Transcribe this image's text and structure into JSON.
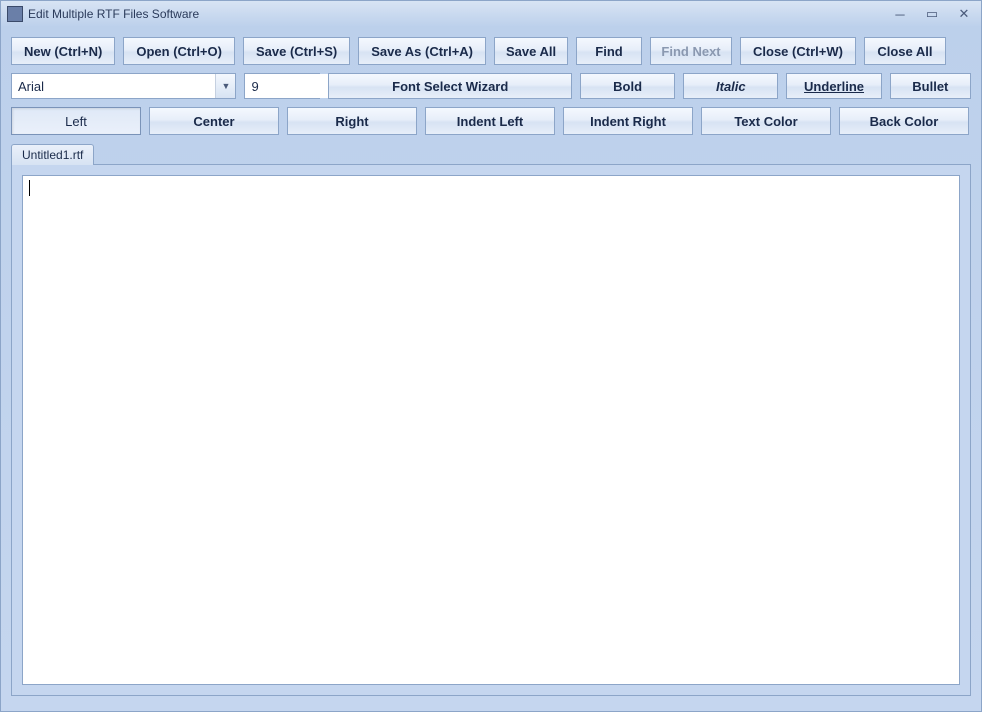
{
  "titlebar": {
    "title": "Edit Multiple RTF Files Software"
  },
  "toolbar1": {
    "new": "New (Ctrl+N)",
    "open": "Open (Ctrl+O)",
    "save": "Save (Ctrl+S)",
    "saveas": "Save As (Ctrl+A)",
    "saveall": "Save All",
    "find": "Find",
    "findnext": "Find Next",
    "close": "Close (Ctrl+W)",
    "closeall": "Close All"
  },
  "toolbar2": {
    "font_name": "Arial",
    "font_size": "9",
    "wizard": "Font Select Wizard",
    "bold": "Bold",
    "italic": "Italic",
    "underline": "Underline",
    "bullet": "Bullet"
  },
  "toolbar3": {
    "left": "Left",
    "center": "Center",
    "right": "Right",
    "indent_left": "Indent Left",
    "indent_right": "Indent Right",
    "text_color": "Text Color",
    "back_color": "Back Color"
  },
  "tabs": {
    "active": "Untitled1.rtf"
  },
  "editor": {
    "content": ""
  }
}
